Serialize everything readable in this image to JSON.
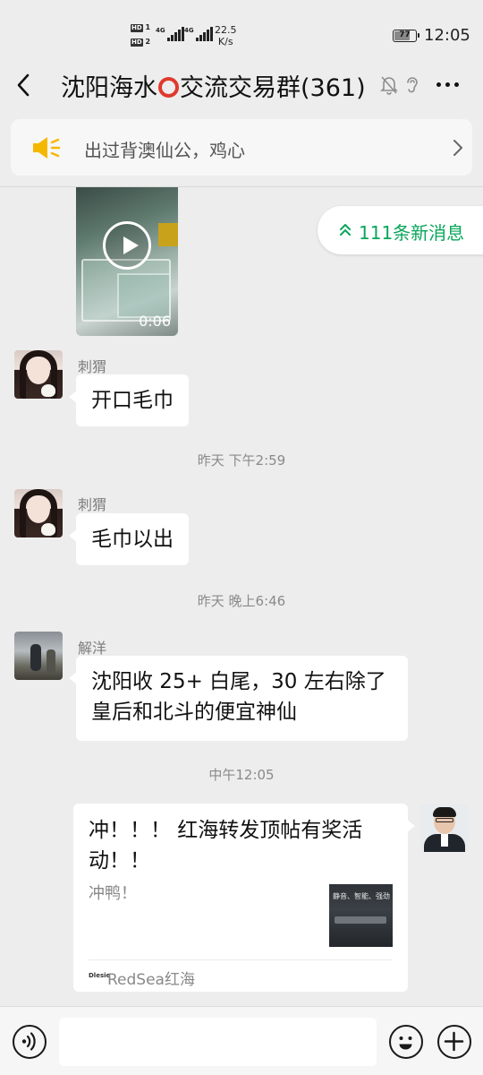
{
  "status_bar": {
    "network_left": "4G",
    "network_right": "4G",
    "speed_value": "22.5",
    "speed_unit": "K/s",
    "battery": "77",
    "battery_level_percent": 77,
    "time": "12:05"
  },
  "header": {
    "title_before_icon": "沈阳海水",
    "title_after_icon": "交流交易群(361)",
    "icons": [
      "back-arrow-icon",
      "red-circle-emoji",
      "mute-bell-icon",
      "ear-icon",
      "more-icon"
    ]
  },
  "announcement": {
    "text": "出过背澳仙公，鸡心",
    "icon": "speaker-icon"
  },
  "new_messages_pill": {
    "label": "111条新消息"
  },
  "video": {
    "duration": "0:06"
  },
  "messages": [
    {
      "sender": "刺猬",
      "text": "开口毛巾"
    },
    {
      "sender": "刺猬",
      "text": "毛巾以出"
    },
    {
      "sender": "解洋",
      "text": "沈阳收 25+ 白尾，30 左右除了皇后和北斗的便宜神仙"
    }
  ],
  "timestamps": [
    "昨天 下午2:59",
    "昨天 晚上6:46",
    "中午12:05"
  ],
  "link_card": {
    "title": "冲！！！ 红海转发顶帖有奖活动！！",
    "description": "冲鸭！",
    "thumbnail_text": "静音、智能、强劲",
    "source_logo": "Dlesie",
    "source": "RedSea红海"
  },
  "input_bar": {
    "placeholder": "",
    "icons": [
      "voice-icon",
      "emoji-icon",
      "plus-icon"
    ]
  },
  "colors": {
    "background": "#ededed",
    "accent_green": "#07a659",
    "emoji_red": "#e03a2e",
    "speaker_yellow": "#f5b800"
  }
}
